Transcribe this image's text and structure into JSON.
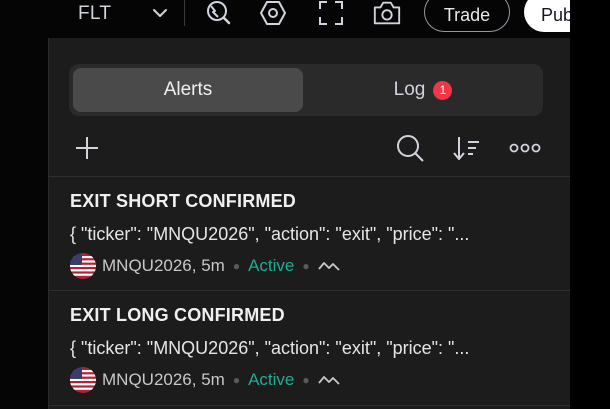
{
  "toolbar": {
    "symbol": "FLT",
    "trade_label": "Trade",
    "publish_label": "Publish",
    "icons": [
      "chevron-down-icon",
      "alert-icon",
      "settings-icon",
      "fullscreen-icon",
      "camera-icon"
    ]
  },
  "panel": {
    "tabs": {
      "alerts_label": "Alerts",
      "log_label": "Log",
      "log_badge": "1"
    },
    "actions": [
      "add-icon",
      "search-icon",
      "sort-icon",
      "more-icon"
    ],
    "alerts": [
      {
        "title": "EXIT SHORT CONFIRMED",
        "message": "{ \"ticker\": \"MNQU2026\", \"action\": \"exit\", \"price\": \"...",
        "symbol_interval": "MNQU2026, 5m",
        "status": "Active"
      },
      {
        "title": "EXIT LONG CONFIRMED",
        "message": "{ \"ticker\": \"MNQU2026\", \"action\": \"exit\", \"price\": \"...",
        "symbol_interval": "MNQU2026, 5m",
        "status": "Active"
      }
    ]
  },
  "colors": {
    "background": "#1c1c1c",
    "active_status": "#22ab94",
    "badge": "#f23645",
    "selected_tab": "#4a4a4a"
  }
}
